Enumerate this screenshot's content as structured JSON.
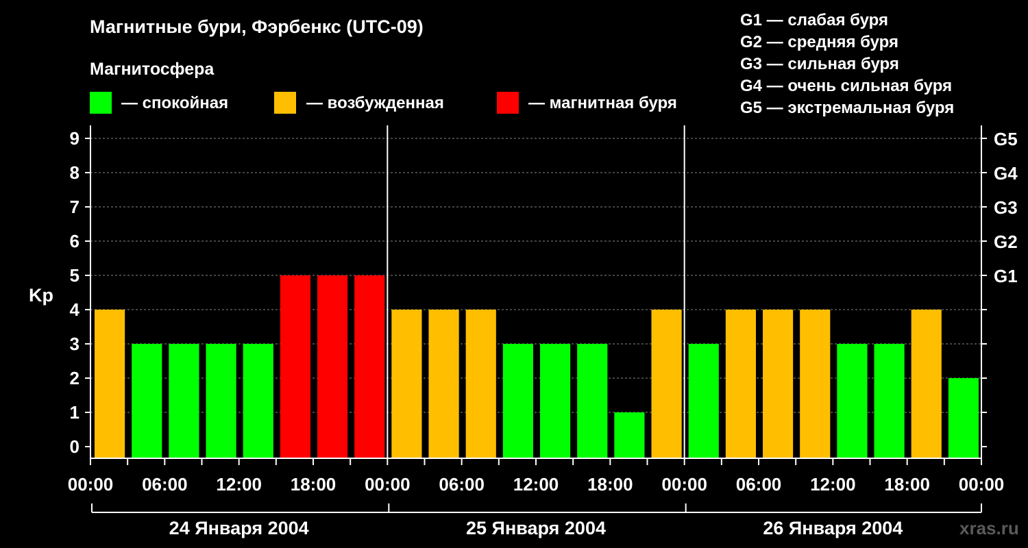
{
  "title": "Магнитные бури, Фэрбенкс (UTC-09)",
  "legend_title": "Магнитосфера",
  "legend": [
    {
      "key": "calm",
      "label": "— спокойная",
      "color": "#00ff00"
    },
    {
      "key": "excited",
      "label": "— возбужденная",
      "color": "#ffbf00"
    },
    {
      "key": "storm",
      "label": "— магнитная буря",
      "color": "#ff0000"
    }
  ],
  "g_scale": [
    "G1 — слабая буря",
    "G2 — средняя буря",
    "G3 — сильная буря",
    "G4 — очень сильная буря",
    "G5 — экстремальная буря"
  ],
  "watermark": "xras.ru",
  "chart_data": {
    "type": "bar",
    "ylabel": "Kp",
    "ylim": [
      0,
      9
    ],
    "yticks": [
      "0",
      "1",
      "2",
      "3",
      "4",
      "5",
      "6",
      "7",
      "8",
      "9"
    ],
    "right_ticks": [
      {
        "value": 5,
        "label": "G1"
      },
      {
        "value": 6,
        "label": "G2"
      },
      {
        "value": 7,
        "label": "G3"
      },
      {
        "value": 8,
        "label": "G4"
      },
      {
        "value": 9,
        "label": "G5"
      }
    ],
    "xtick_labels": [
      "00:00",
      "06:00",
      "12:00",
      "18:00",
      "00:00",
      "06:00",
      "12:00",
      "18:00",
      "00:00",
      "06:00",
      "12:00",
      "18:00",
      "00:00"
    ],
    "days": [
      "24 Января 2004",
      "25 Января 2004",
      "26 Января 2004"
    ],
    "interval_hours": 3,
    "grid": true,
    "values": [
      4,
      3,
      3,
      3,
      3,
      5,
      5,
      5,
      4,
      4,
      4,
      3,
      3,
      3,
      1,
      4,
      3,
      4,
      4,
      4,
      3,
      3,
      4,
      2
    ],
    "categories": [
      "calm",
      "calm",
      "calm",
      "calm",
      "excited",
      "storm"
    ],
    "category_of_value": [
      "excited",
      "calm",
      "calm",
      "calm",
      "calm",
      "storm",
      "storm",
      "storm",
      "excited",
      "excited",
      "excited",
      "calm",
      "calm",
      "calm",
      "calm",
      "excited",
      "calm",
      "excited",
      "excited",
      "excited",
      "calm",
      "calm",
      "excited",
      "calm"
    ]
  }
}
